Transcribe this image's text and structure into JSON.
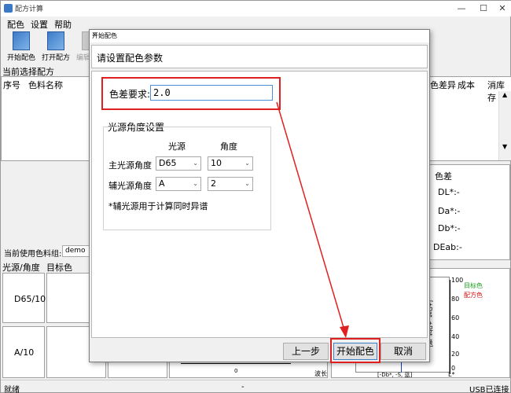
{
  "app": {
    "title": "配方计算",
    "minimize": "—",
    "maximize": "☐",
    "close": "✕"
  },
  "menu": [
    "配色",
    "设置",
    "帮助"
  ],
  "toolbar": {
    "start": "开始配色",
    "open": "打开配方",
    "edit": "编辑配方"
  },
  "main": {
    "current_recipe_label": "当前选择配方",
    "table_headers": {
      "seq": "序号",
      "name": "色料名称",
      "diff": "色差异",
      "cost": "成本",
      "stock": "消库存"
    },
    "color_diff": {
      "title": "色差",
      "dl": "DL*:-",
      "da": "Da*:-",
      "db": "Db*:-",
      "deab": "DEab:-"
    },
    "color_group_label": "当前使用色料组:",
    "color_group_value": "demo",
    "light_header": "光源/角度",
    "target_header": "目标色",
    "row1": "D65/10",
    "row2": "A/10",
    "chart": {
      "y_top": "100",
      "legend_target": "目标色",
      "legend_recipe": "配方色",
      "ticks": [
        "80",
        "60",
        "40",
        "20",
        "0"
      ],
      "side_label": "[+Da*, +Db*, 黄]",
      "bottom_label": "[-Db*, -S, 蓝]",
      "lstar": "L*",
      "zero": "0",
      "wave": "波长"
    }
  },
  "status": {
    "left": "就绪",
    "mid": "-",
    "right": "USB已连接"
  },
  "dialog": {
    "title": "开始配色",
    "close": "✕",
    "header": "请设置配色参数",
    "diff_label": "色差要求:",
    "diff_value": "2.0",
    "group_title": "光源角度设置",
    "col_light": "光源",
    "col_angle": "角度",
    "main_label": "主光源角度",
    "main_light": "D65",
    "main_angle": "10",
    "aux_label": "辅光源角度",
    "aux_light": "A",
    "aux_angle": "2",
    "note": "*辅光源用于计算同时异谱",
    "prev": "上一步",
    "start": "开始配色",
    "cancel": "取消"
  },
  "colors": {
    "accent": "#e02020",
    "legend_target": "#1a9a1a",
    "legend_recipe": "#d01010"
  }
}
